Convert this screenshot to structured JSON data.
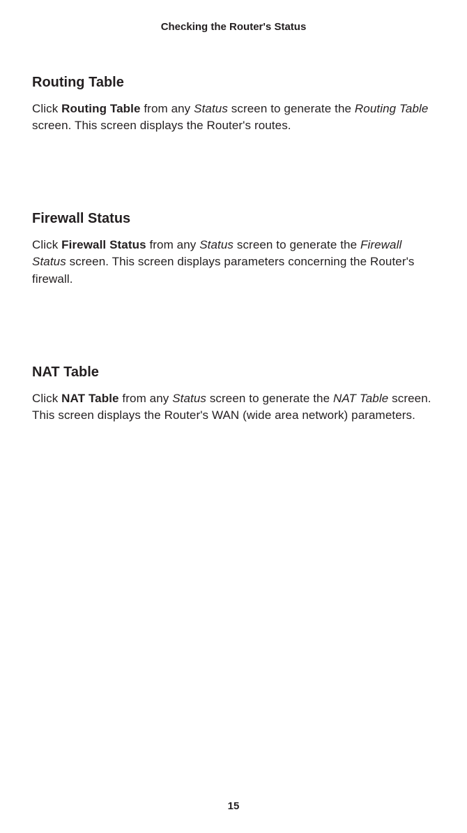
{
  "header": {
    "title": "Checking the Router's Status"
  },
  "sections": [
    {
      "heading": "Routing Table",
      "body_parts": {
        "p1": "Click ",
        "b1": "Routing Table",
        "p2": " from any ",
        "i1": "Status",
        "p3": " screen to generate the ",
        "i2": "Routing Table",
        "p4": " screen. This screen displays the Router's routes."
      }
    },
    {
      "heading": "Firewall Status",
      "body_parts": {
        "p1": "Click ",
        "b1": "Firewall Status",
        "p2": " from any ",
        "i1": "Status",
        "p3": " screen to generate the ",
        "i2": "Firewall Status",
        "p4": " screen. This screen displays parameters concerning the Router's firewall."
      }
    },
    {
      "heading": "NAT Table",
      "body_parts": {
        "p1": "Click ",
        "b1": "NAT Table",
        "p2": " from any ",
        "i1": "Status",
        "p3": " screen to generate the ",
        "i2": "NAT Table",
        "p4": " screen. This screen displays the Router's WAN (wide area network) parameters."
      }
    }
  ],
  "footer": {
    "page_number": "15"
  }
}
